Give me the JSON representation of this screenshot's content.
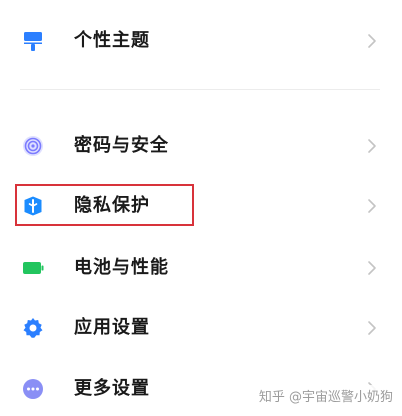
{
  "colors": {
    "highlight_border": "#d8323a",
    "theme_icon": "#2b7fff",
    "password_icon": "#7b7bff",
    "privacy_icon": "#1b8cff",
    "battery_icon": "#22c55e",
    "apps_icon": "#2b7fff",
    "more_icon": "#8a8ff5"
  },
  "settings": {
    "items": [
      {
        "label": "个性主题",
        "icon": "paint-roller-icon"
      },
      {
        "label": "密码与安全",
        "icon": "fingerprint-icon"
      },
      {
        "label": "隐私保护",
        "icon": "privacy-shield-icon",
        "highlighted": true
      },
      {
        "label": "电池与性能",
        "icon": "battery-icon"
      },
      {
        "label": "应用设置",
        "icon": "gear-icon"
      },
      {
        "label": "更多设置",
        "icon": "more-dots-icon"
      }
    ]
  },
  "watermark": {
    "text": "知乎 @宇宙巡警小奶狗"
  }
}
